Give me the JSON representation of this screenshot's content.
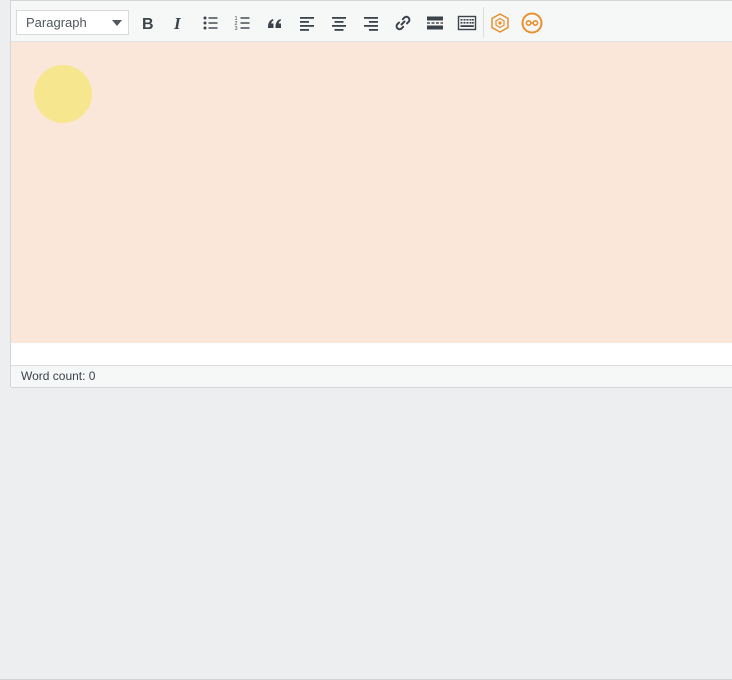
{
  "toolbar": {
    "format_select": {
      "selected": "Paragraph"
    },
    "buttons": [
      {
        "name": "bold-button",
        "icon": "bold-icon"
      },
      {
        "name": "italic-button",
        "icon": "italic-icon"
      },
      {
        "name": "bulleted-list-button",
        "icon": "bulleted-list-icon"
      },
      {
        "name": "numbered-list-button",
        "icon": "numbered-list-icon"
      },
      {
        "name": "blockquote-button",
        "icon": "blockquote-icon"
      },
      {
        "name": "align-left-button",
        "icon": "align-left-icon"
      },
      {
        "name": "align-center-button",
        "icon": "align-center-icon"
      },
      {
        "name": "align-right-button",
        "icon": "align-right-icon"
      },
      {
        "name": "insert-link-button",
        "icon": "link-icon"
      },
      {
        "name": "read-more-button",
        "icon": "read-more-icon"
      },
      {
        "name": "toolbar-toggle-button",
        "icon": "keyboard-icon"
      },
      {
        "name": "plugin-hexagon-button",
        "icon": "hexagon-plugin-icon"
      },
      {
        "name": "plugin-circle-button",
        "icon": "circle-plugin-icon"
      }
    ]
  },
  "statusbar": {
    "word_count": "Word count: 0"
  },
  "colors": {
    "toolbar_bg": "#f6f7f7",
    "content_bg": "#fbe7d9",
    "cursor_highlight": "#f6e78f",
    "icon": "#3c434a",
    "plugin_accent": "#e8902e",
    "page_bg": "#eceeef"
  }
}
